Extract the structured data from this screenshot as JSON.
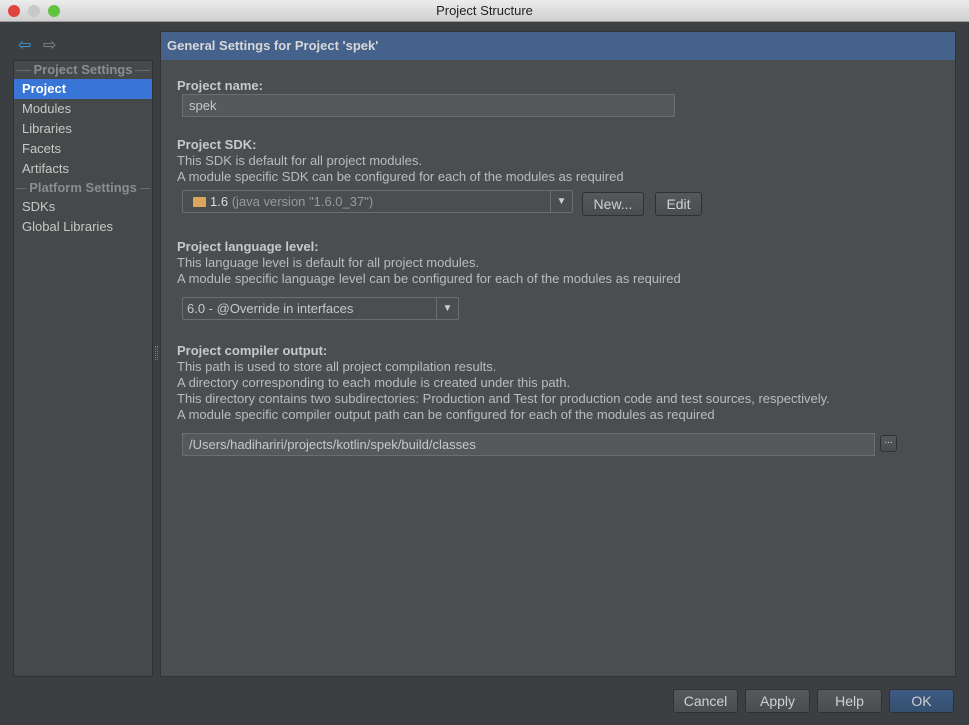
{
  "window": {
    "title": "Project Structure"
  },
  "nav": {
    "back": "back-arrow",
    "forward": "forward-arrow"
  },
  "sidebar": {
    "project_settings_header": "Project Settings",
    "project_items": [
      {
        "label": "Project",
        "selected": true
      },
      {
        "label": "Modules"
      },
      {
        "label": "Libraries"
      },
      {
        "label": "Facets"
      },
      {
        "label": "Artifacts"
      }
    ],
    "platform_settings_header": "Platform Settings",
    "platform_items": [
      {
        "label": "SDKs"
      },
      {
        "label": "Global Libraries"
      }
    ]
  },
  "main": {
    "header": "General Settings for Project 'spek'",
    "project_name": {
      "label": "Project name:",
      "value": "spek"
    },
    "sdk": {
      "label": "Project SDK:",
      "desc1": "This SDK is default for all project modules.",
      "desc2": "A module specific SDK can be configured for each of the modules as required",
      "selected_version": "1.6",
      "selected_detail": "(java version \"1.6.0_37\")",
      "new_button": "New...",
      "edit_button": "Edit"
    },
    "language": {
      "label": "Project language level:",
      "desc1": "This language level is default for all project modules.",
      "desc2": "A module specific language level can be configured for each of the modules as required",
      "selected": "6.0 - @Override in interfaces"
    },
    "compiler": {
      "label": "Project compiler output:",
      "desc1": "This path is used to store all project compilation results.",
      "desc2": "A directory corresponding to each module is created under this path.",
      "desc3": "This directory contains two subdirectories: Production and Test for production code and test sources, respectively.",
      "desc4": "A module specific compiler output path can be configured for each of the modules as required",
      "path": "/Users/hadihariri/projects/kotlin/spek/build/classes",
      "browse": "..."
    }
  },
  "footer": {
    "cancel": "Cancel",
    "apply": "Apply",
    "help": "Help",
    "ok": "OK"
  },
  "colors": {
    "selection": "#3875d7",
    "header": "#45628c",
    "ok_button": "#3e5a82"
  }
}
